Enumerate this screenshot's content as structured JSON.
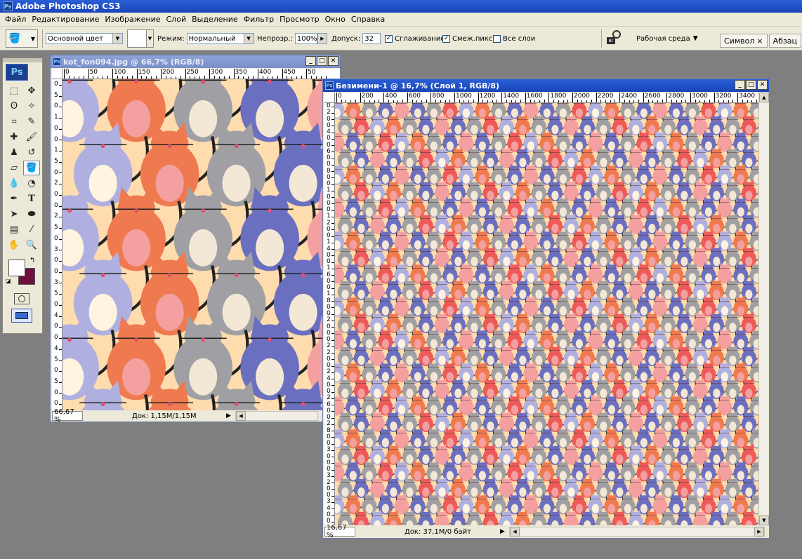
{
  "app": {
    "title": "Adobe Photoshop CS3",
    "logo": "Ps"
  },
  "menu": [
    "Файл",
    "Редактирование",
    "Изображение",
    "Слой",
    "Выделение",
    "Фильтр",
    "Просмотр",
    "Окно",
    "Справка"
  ],
  "options": {
    "fill_source": "Основной цвет",
    "mode_label": "Режим:",
    "mode_value": "Нормальный",
    "opacity_label": "Непрозр.:",
    "opacity_value": "100%",
    "tolerance_label": "Допуск:",
    "tolerance_value": "32",
    "antialias_label": "Сглаживание",
    "antialias_checked": true,
    "contiguous_label": "Смеж.пикс",
    "contiguous_checked": true,
    "all_layers_label": "Все слои",
    "all_layers_checked": false,
    "workspace_label": "Рабочая среда"
  },
  "panel_tabs": [
    {
      "label": "Символ",
      "close": "×"
    },
    {
      "label": "Абзац"
    }
  ],
  "toolbox": {
    "logo": "Ps",
    "foreground_color": "#ffffff",
    "background_color": "#6e0f3e"
  },
  "doc1": {
    "title": "kot_fon094.jpg @ 66,7% (RGB/8)",
    "ruler_h": [
      "0",
      "50",
      "100",
      "150",
      "200",
      "250",
      "300",
      "350",
      "400",
      "450",
      "50"
    ],
    "ruler_v": [
      "0",
      "5",
      "0",
      "1",
      "0",
      "0",
      "1",
      "5",
      "0",
      "2",
      "0",
      "0",
      "2",
      "5",
      "0",
      "3",
      "0",
      "0",
      "3",
      "5",
      "0",
      "4",
      "0",
      "0",
      "4",
      "5",
      "0",
      "5",
      "0",
      "0"
    ],
    "zoom": "66,67 %",
    "status": "Док: 1,15M/1,15M"
  },
  "doc2": {
    "title": "Безимени-1 @ 16,7% (Слой 1, RGB/8)",
    "ruler_h": [
      "0",
      "200",
      "400",
      "600",
      "800",
      "1000",
      "1200",
      "1400",
      "1600",
      "1800",
      "2000",
      "2200",
      "2400",
      "2600",
      "2800",
      "3000",
      "3200",
      "3400"
    ],
    "ruler_v": [
      "0",
      "2",
      "0",
      "0",
      "4",
      "0",
      "0",
      "6",
      "0",
      "0",
      "8",
      "0",
      "0",
      "1",
      "0",
      "0",
      "0",
      "1",
      "2",
      "0",
      "0",
      "1",
      "4",
      "0",
      "0",
      "1",
      "6",
      "0",
      "0",
      "1",
      "8",
      "0",
      "0",
      "2",
      "0",
      "0",
      "0",
      "2",
      "2",
      "0",
      "0",
      "2",
      "4",
      "0",
      "0",
      "2",
      "6",
      "0",
      "0",
      "2",
      "8",
      "0",
      "0",
      "3",
      "0",
      "0",
      "0",
      "3",
      "2",
      "0",
      "0",
      "3",
      "4",
      "0",
      "0"
    ],
    "zoom": "16,67 %",
    "status": "Док: 37,1M/0 байт"
  },
  "palette": {
    "cream": "#ffdcae",
    "lavender": "#b0b0e0",
    "indigo": "#6b6fc0",
    "grey": "#a0a0a4",
    "orange": "#f07a50",
    "pink": "#f4a0a0",
    "red": "#ee5a5a"
  }
}
